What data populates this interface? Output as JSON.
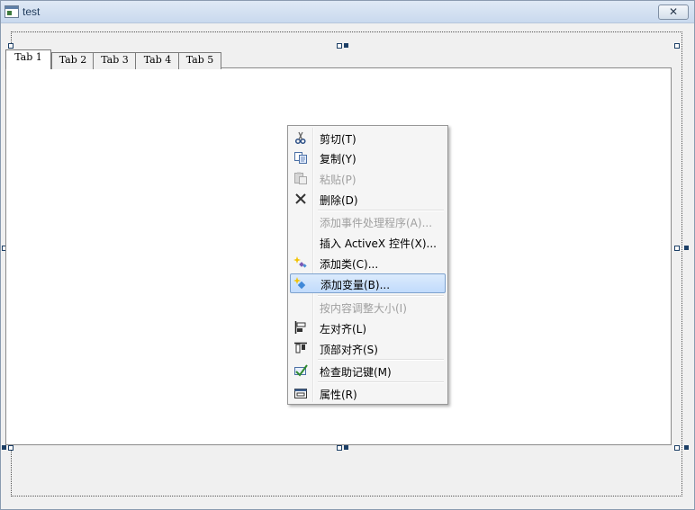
{
  "window": {
    "title": "test",
    "close_glyph": "✕"
  },
  "tabs": [
    {
      "label": "Tab 1",
      "active": true
    },
    {
      "label": "Tab 2",
      "active": false
    },
    {
      "label": "Tab 3",
      "active": false
    },
    {
      "label": "Tab 4",
      "active": false
    },
    {
      "label": "Tab 5",
      "active": false
    }
  ],
  "context_menu": {
    "items": [
      {
        "label": "剪切(T)",
        "icon": "scissors-icon",
        "disabled": false
      },
      {
        "label": "复制(Y)",
        "icon": "copy-icon",
        "disabled": false
      },
      {
        "label": "粘贴(P)",
        "icon": "paste-icon",
        "disabled": true
      },
      {
        "label": "删除(D)",
        "icon": "delete-icon",
        "disabled": false
      },
      {
        "label": "添加事件处理程序(A)...",
        "icon": "",
        "disabled": true
      },
      {
        "label": "插入 ActiveX 控件(X)...",
        "icon": "",
        "disabled": false
      },
      {
        "label": "添加类(C)...",
        "icon": "add-class-icon",
        "disabled": false
      },
      {
        "label": "添加变量(B)...",
        "icon": "add-variable-icon",
        "disabled": false,
        "highlighted": true
      },
      {
        "label": "按内容调整大小(I)",
        "icon": "",
        "disabled": true
      },
      {
        "label": "左对齐(L)",
        "icon": "align-left-icon",
        "disabled": false
      },
      {
        "label": "顶部对齐(S)",
        "icon": "align-top-icon",
        "disabled": false
      },
      {
        "label": "检查助记键(M)",
        "icon": "check-mnemonic-icon",
        "disabled": false
      },
      {
        "label": "属性(R)",
        "icon": "properties-icon",
        "disabled": false
      }
    ]
  },
  "colors": {
    "selection_handle": "#1c3f66",
    "menu_highlight": "#c1dbfc"
  }
}
